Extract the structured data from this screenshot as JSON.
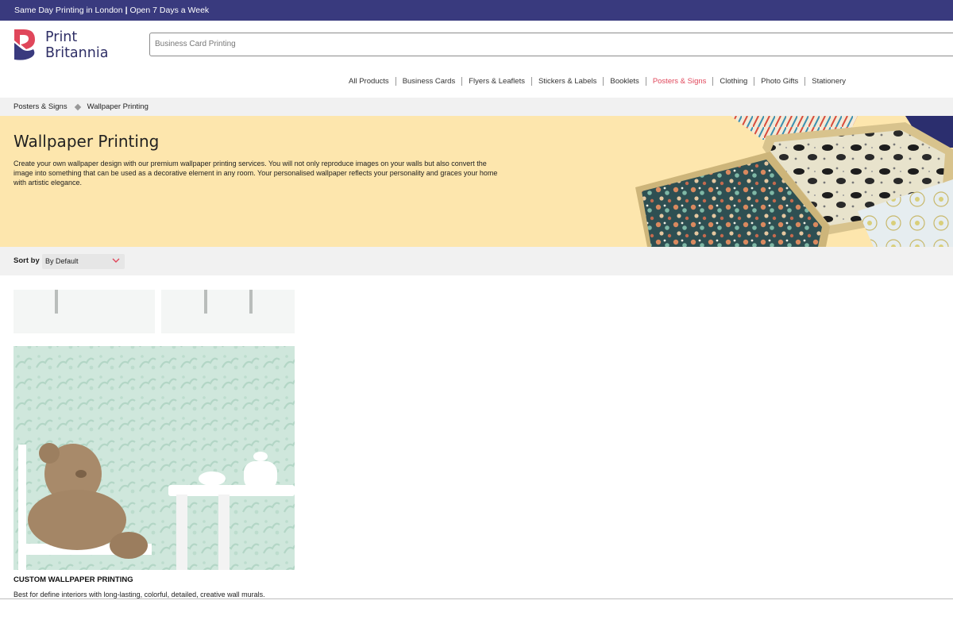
{
  "topbar": {
    "part1": "Same Day Printing in London",
    "separator": "|",
    "part2": "Open 7 Days a Week"
  },
  "brand": {
    "line1": "Print",
    "line2": "Britannia",
    "colors": {
      "navy": "#393a7e",
      "red": "#e0475b"
    }
  },
  "search": {
    "placeholder": "Business Card Printing"
  },
  "nav": {
    "items": [
      {
        "label": "All Products"
      },
      {
        "label": "Business Cards"
      },
      {
        "label": "Flyers & Leaflets"
      },
      {
        "label": "Stickers & Labels"
      },
      {
        "label": "Booklets"
      },
      {
        "label": "Posters & Signs",
        "active": true
      },
      {
        "label": "Clothing"
      },
      {
        "label": "Photo Gifts"
      },
      {
        "label": "Stationery"
      }
    ]
  },
  "breadcrumb": {
    "parent": "Posters & Signs",
    "current": "Wallpaper Printing"
  },
  "hero": {
    "title": "Wallpaper Printing",
    "description": "Create your own wallpaper design with our premium wallpaper printing services. You will not only reproduce images on your walls but also convert the image into something that can be used as a decorative element in any room. Your personalised wallpaper reflects your personality and graces your home with artistic elegance.",
    "background": "#fde6ad"
  },
  "sort": {
    "label": "Sort by",
    "selected": "By Default",
    "icon": "chevron-down-icon"
  },
  "products": [
    {
      "title": "CUSTOM WALLPAPER PRINTING",
      "description": "Best for define interiors with long-lasting, colorful, detailed, creative wall murals."
    }
  ]
}
